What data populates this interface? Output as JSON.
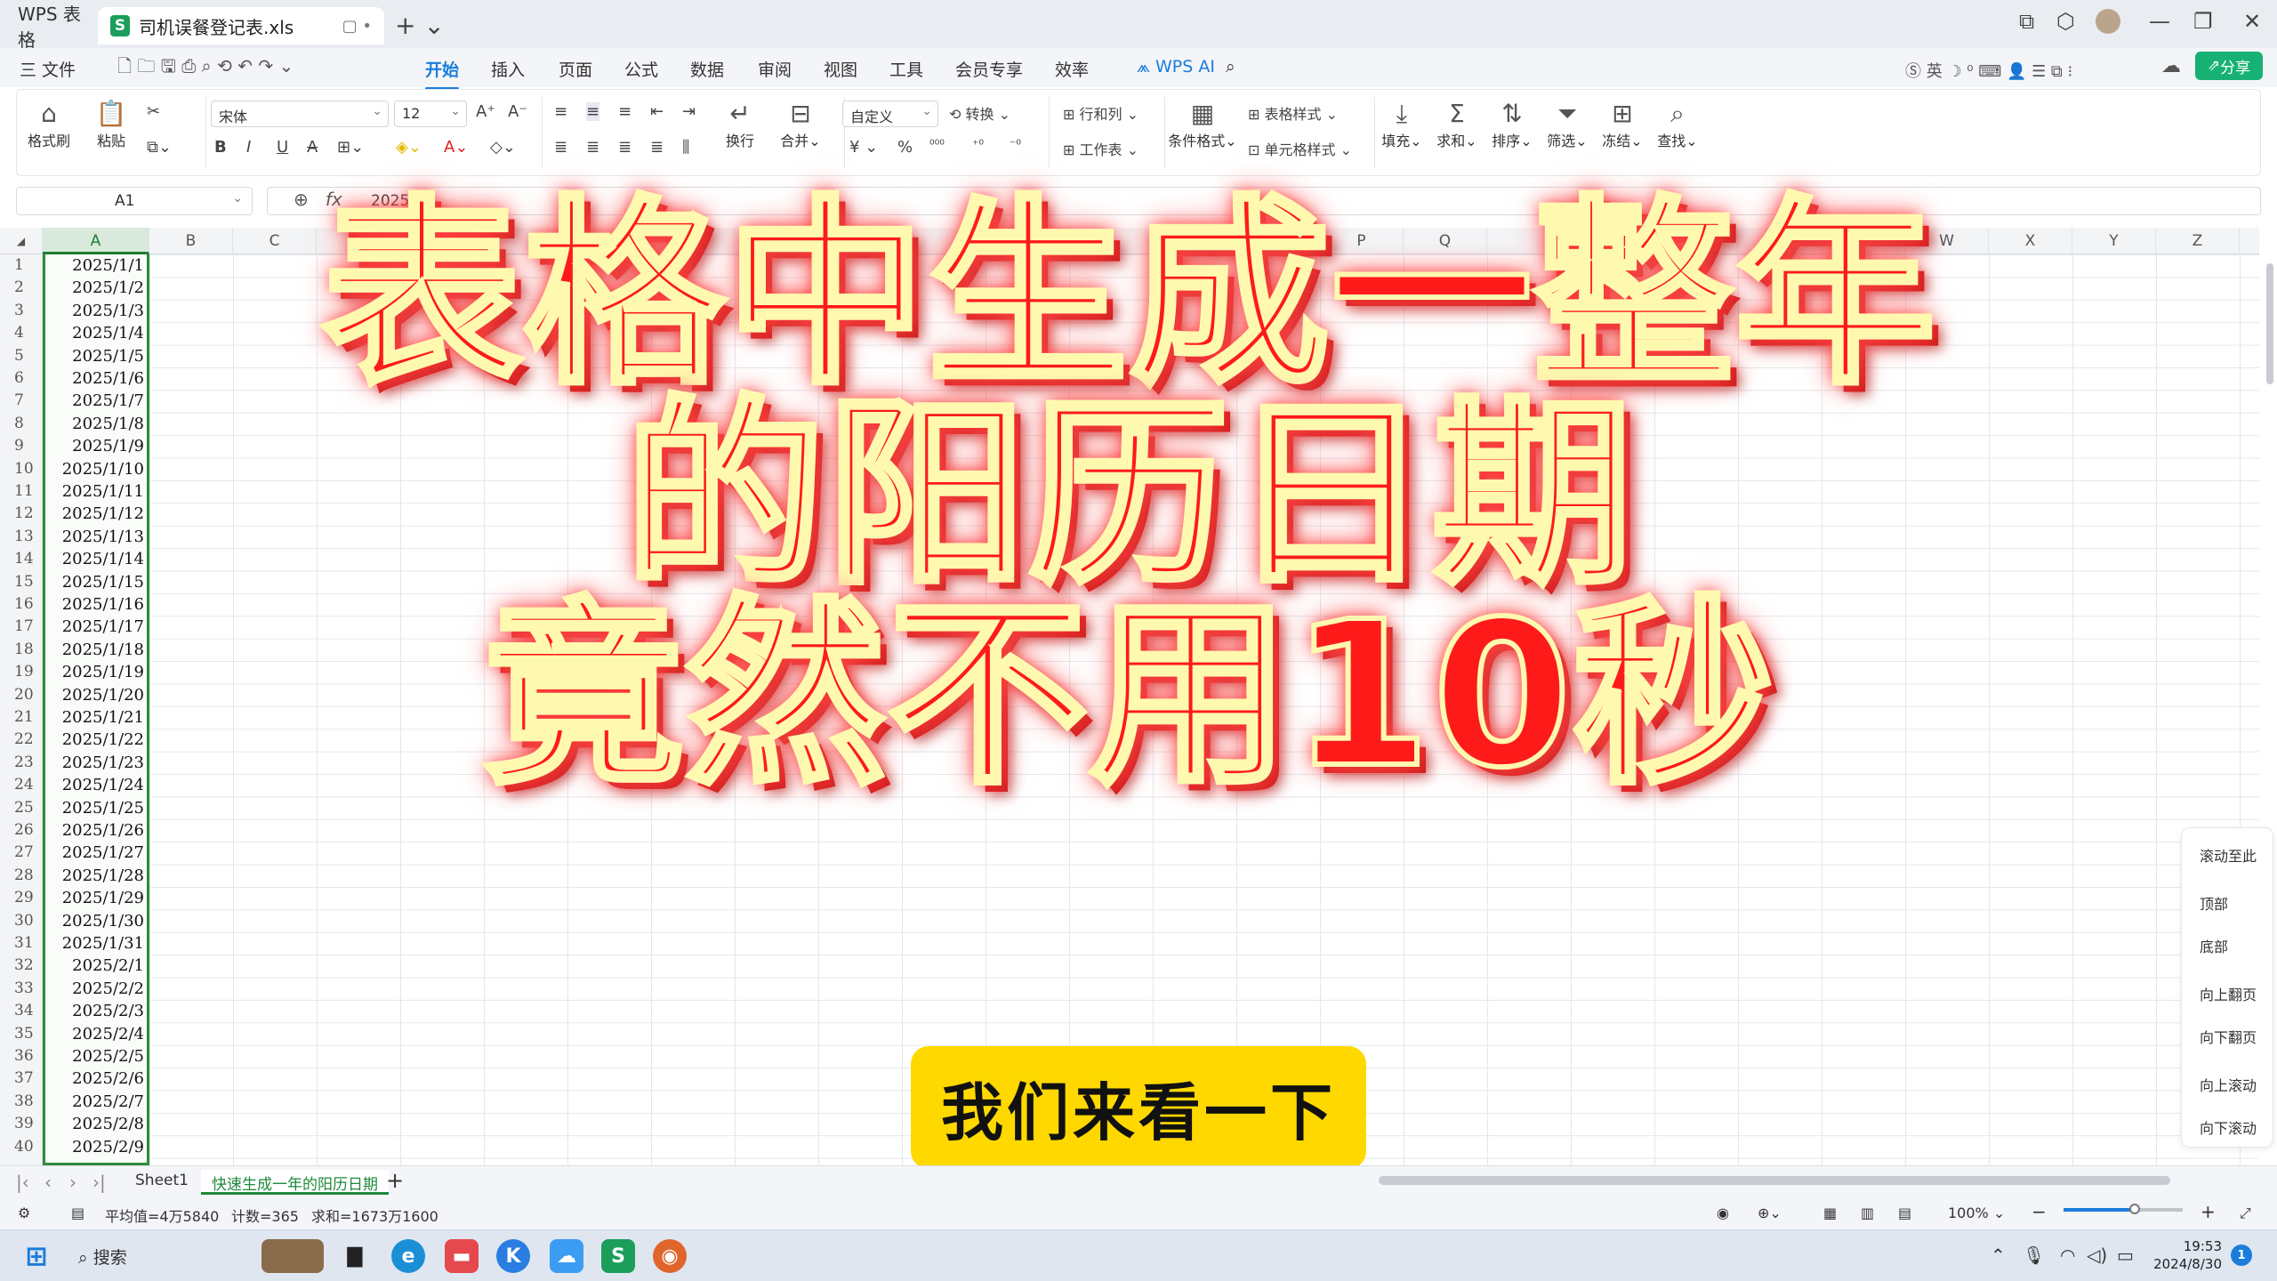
{
  "titlebar": {
    "app_tab": "WPS 表格",
    "doc_tab": "司机误餐登记表.xls",
    "doc_icon": "S"
  },
  "menubar": {
    "file": "三 文件",
    "items": [
      "开始",
      "插入",
      "页面",
      "公式",
      "数据",
      "审阅",
      "视图",
      "工具",
      "会员专享",
      "效率"
    ],
    "active": "开始",
    "wps_ai": "WPS AI",
    "share": "分享"
  },
  "ribbon": {
    "format_painter": "格式刷",
    "paste": "粘贴",
    "font_name": "宋体",
    "font_size": "12",
    "wrap": "换行",
    "merge": "合并",
    "number_format": "自定义",
    "convert": "转换",
    "row_col": "行和列",
    "worksheet": "工作表",
    "cond_format": "条件格式",
    "table_style": "表格样式",
    "cell_style": "单元格样式",
    "fill": "填充",
    "sum": "求和",
    "sort": "排序",
    "filter": "筛选",
    "freeze": "冻结",
    "find": "查找",
    "currency": "¥",
    "percent": "%"
  },
  "formula_bar": {
    "name_box": "A1",
    "fx": "fx",
    "value": "2025/1/1"
  },
  "columns": [
    "A",
    "B",
    "C",
    "",
    "",
    "",
    "",
    "",
    "",
    "",
    "",
    "M",
    "",
    "",
    "",
    "P",
    "Q",
    "",
    "",
    "",
    "",
    "",
    "W",
    "X",
    "Y",
    "Z"
  ],
  "rows": [
    "1",
    "2",
    "3",
    "4",
    "5",
    "6",
    "7",
    "8",
    "9",
    "10",
    "11",
    "12",
    "13",
    "14",
    "15",
    "16",
    "17",
    "18",
    "19",
    "20",
    "21",
    "22",
    "23",
    "24",
    "25",
    "26",
    "27",
    "28",
    "29",
    "30",
    "31",
    "32",
    "33",
    "34",
    "35",
    "36",
    "37",
    "38",
    "39",
    "40"
  ],
  "column_a": [
    "2025/1/1",
    "2025/1/2",
    "2025/1/3",
    "2025/1/4",
    "2025/1/5",
    "2025/1/6",
    "2025/1/7",
    "2025/1/8",
    "2025/1/9",
    "2025/1/10",
    "2025/1/11",
    "2025/1/12",
    "2025/1/13",
    "2025/1/14",
    "2025/1/15",
    "2025/1/16",
    "2025/1/17",
    "2025/1/18",
    "2025/1/19",
    "2025/1/20",
    "2025/1/21",
    "2025/1/22",
    "2025/1/23",
    "2025/1/24",
    "2025/1/25",
    "2025/1/26",
    "2025/1/27",
    "2025/1/28",
    "2025/1/29",
    "2025/1/30",
    "2025/1/31",
    "2025/2/1",
    "2025/2/2",
    "2025/2/3",
    "2025/2/4",
    "2025/2/5",
    "2025/2/6",
    "2025/2/7",
    "2025/2/8",
    "2025/2/9"
  ],
  "overlay": {
    "line1": "表格中生成一整年",
    "line2": "的阳历日期",
    "line3": "竟然不用10秒",
    "caption": "我们来看一下"
  },
  "side_panel": [
    "滚动至此",
    "顶部",
    "底部",
    "向上翻页",
    "向下翻页",
    "向上滚动",
    "向下滚动"
  ],
  "sheets": {
    "tabs": [
      "Sheet1",
      "快速生成一年的阳历日期"
    ],
    "active": "快速生成一年的阳历日期"
  },
  "statusbar": {
    "average": "平均值=4万5840",
    "count": "计数=365",
    "sum": "求和=1673万1600",
    "zoom": "100%",
    "zoom_level": 0.6
  },
  "taskbar": {
    "search": "搜索",
    "time": "19:53",
    "date": "2024/8/30",
    "notifications": "1"
  },
  "colors": {
    "accent": "#1b7ddb",
    "selection": "#2e8b3d",
    "overlay_red": "#ff1a1a",
    "caption_yellow": "#ffd800"
  }
}
